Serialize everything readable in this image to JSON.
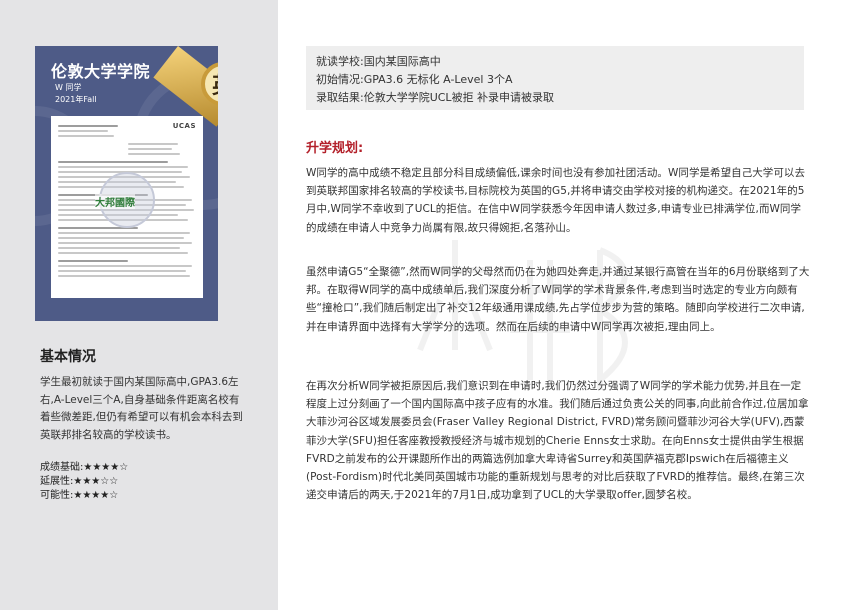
{
  "cover": {
    "title": "伦敦大学学院",
    "subtitle1": "W 同学",
    "subtitle2": "2021年Fall",
    "badge": "英",
    "letter_logo": "UCAS",
    "watermark": "大邦國際"
  },
  "sidebar": {
    "section_title": "基本情况",
    "description": "学生最初就读于国内某国际高中,GPA3.6左右,A-Level三个A,自身基础条件距离名校有着些微差距,但仍有希望可以有机会本科去到英联邦排名较高的学校读书。",
    "ratings": [
      {
        "label": "成绩基础:",
        "stars": "★★★★☆",
        "value": 4
      },
      {
        "label": "延展性:",
        "stars": "★★★☆☆",
        "value": 3
      },
      {
        "label": "可能性:",
        "stars": "★★★★☆",
        "value": 4
      }
    ]
  },
  "info": {
    "school": "就读学校:国内某国际高中",
    "initial": "初始情况:GPA3.6 无标化 A-Level 3个A",
    "result": "录取结果:伦敦大学学院UCL被拒 补录申请被录取"
  },
  "plan": {
    "title": "升学规划:",
    "paragraphs": [
      "W同学的高中成绩不稳定且部分科目成绩偏低,课余时间也没有参加社团活动。W同学是希望自己大学可以去到英联邦国家排名较高的学校读书,目标院校为英国的G5,并将申请交由学校对接的机构递交。在2021年的5月中,W同学不幸收到了UCL的拒信。在信中W同学获悉今年因申请人数过多,申请专业已排满学位,而W同学的成绩在申请人中竞争力尚属有限,故只得婉拒,名落孙山。",
      "虽然申请G5“全聚德”,然而W同学的父母然而仍在为她四处奔走,并通过某银行高管在当年的6月份联络到了大邦。在取得W同学的高中成绩单后,我们深度分析了W同学的学术背景条件,考虑到当时选定的专业方向颇有些“撞枪口”,我们随后制定出了补交12年级通用课成绩,先占学位步步为营的策略。随即向学校进行二次申请,并在申请界面中选择有大学学分的选项。然而在后续的申请中W同学再次被拒,理由同上。",
      "在再次分析W同学被拒原因后,我们意识到在申请时,我们仍然过分强调了W同学的学术能力优势,并且在一定程度上过分刻画了一个国内国际高中孩子应有的水准。我们随后通过负责公关的同事,向此前合作过,位居加拿大菲沙河谷区域发展委员会(Fraser Valley Regional District, FVRD)常务顾问暨菲沙河谷大学(UFV),西蒙菲沙大学(SFU)担任客座教授教授经济与城市规划的Cherie Enns女士求助。在向Enns女士提供由学生根据FVRD之前发布的公开课题所作出的两篇选例加拿大卑诗省Surrey和英国萨福克郡Ipswich在后福德主义(Post-Fordism)时代北美同英国城市功能的重新规划与思考的对比后获取了FVRD的推荐信。最终,在第三次递交申请后的两天,于2021年的7月1日,成功拿到了UCL的大学录取offer,圆梦名校。"
    ]
  }
}
